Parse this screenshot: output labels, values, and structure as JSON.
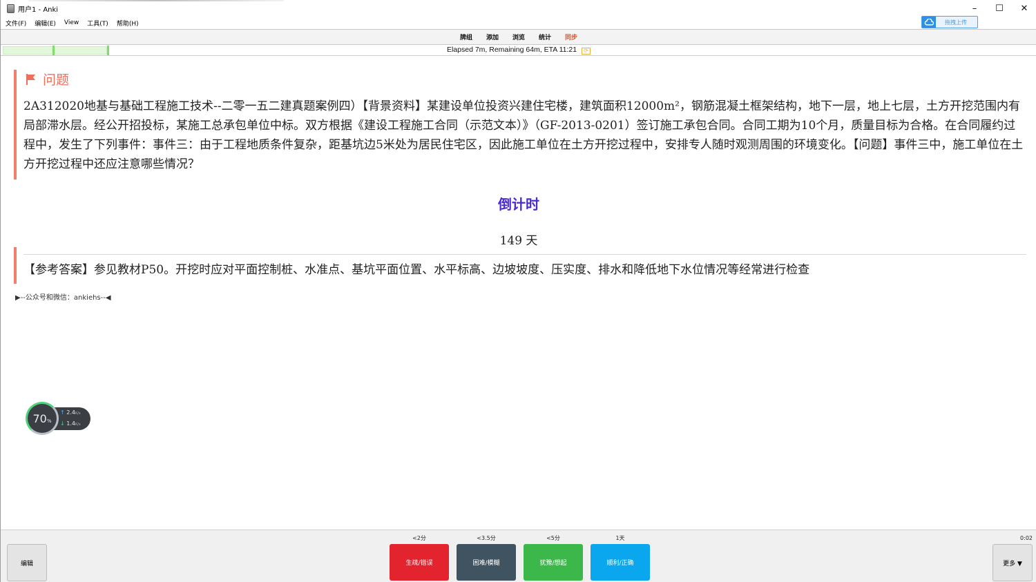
{
  "window": {
    "title": "用户1 - Anki",
    "minimize": "–",
    "maximize": "☐",
    "close": "✕"
  },
  "menu": {
    "items": [
      "文件(F)",
      "编辑(E)",
      "View",
      "工具(T)",
      "帮助(H)"
    ]
  },
  "upload": {
    "icon": "cloud-icon",
    "label": "拖拽上传"
  },
  "toolbar": {
    "items": [
      "牌组",
      "添加",
      "浏览",
      "统计",
      "同步"
    ],
    "sync_color": "#e0552a"
  },
  "progress": {
    "text": "Elapsed 7m, Remaining 64m, ETA 11:21",
    "icon": "refresh-icon",
    "fraction_complete": 0.1
  },
  "card": {
    "question_heading": "问题",
    "question_text": "2A312020地基与基础工程施工技术--二零一五二建真题案例四）【背景资料】某建设单位投资兴建住宅楼，建筑面积12000m²，钢筋混凝土框架结构，地下一层，地上七层，土方开挖范围内有局部滞水层。经公开招投标，某施工总承包单位中标。双方根据《建设工程施工合同（示范文本）》（GF-2013-0201）签订施工承包合同。合同工期为10个月，质量目标为合格。在合同履约过程中，发生了下列事件：事件三：由于工程地质条件复杂，距基坑边5米处为居民住宅区，因此施工单位在土方开挖过程中，安排专人随时观测周围的环境变化。【问题】事件三中，施工单位在土方开挖过程中还应注意哪些情况？",
    "countdown_title": "倒计时",
    "countdown_value": "149 天",
    "answer_text": "【参考答案】参见教材P50。开挖时应对平面控制桩、水准点、基坑平面位置、水平标高、边坡坡度、压实度、排水和降低地下水位情况等经常进行检查",
    "footnote": "▶--公众号和微信：ankiehs--◀",
    "accent_color": "#f07f6e",
    "countdown_color": "#4b2bd0"
  },
  "net_widget": {
    "percent": "70",
    "percent_unit": "%",
    "up_value": "2.4",
    "up_unit": "K/s",
    "down_value": "1.4",
    "down_unit": "K/s"
  },
  "bottom": {
    "edit_label": "编辑",
    "more_label": "更多 ▼",
    "timer": "0:02",
    "answers": [
      {
        "interval": "<2分",
        "label": "生疏/错误",
        "color": "#e3242e"
      },
      {
        "interval": "<3.5分",
        "label": "困难/模糊",
        "color": "#3f5361"
      },
      {
        "interval": "<5分",
        "label": "犹豫/想起",
        "color": "#3cb84a"
      },
      {
        "interval": "1天",
        "label": "顺利/正确",
        "color": "#0aa7ee"
      }
    ]
  }
}
